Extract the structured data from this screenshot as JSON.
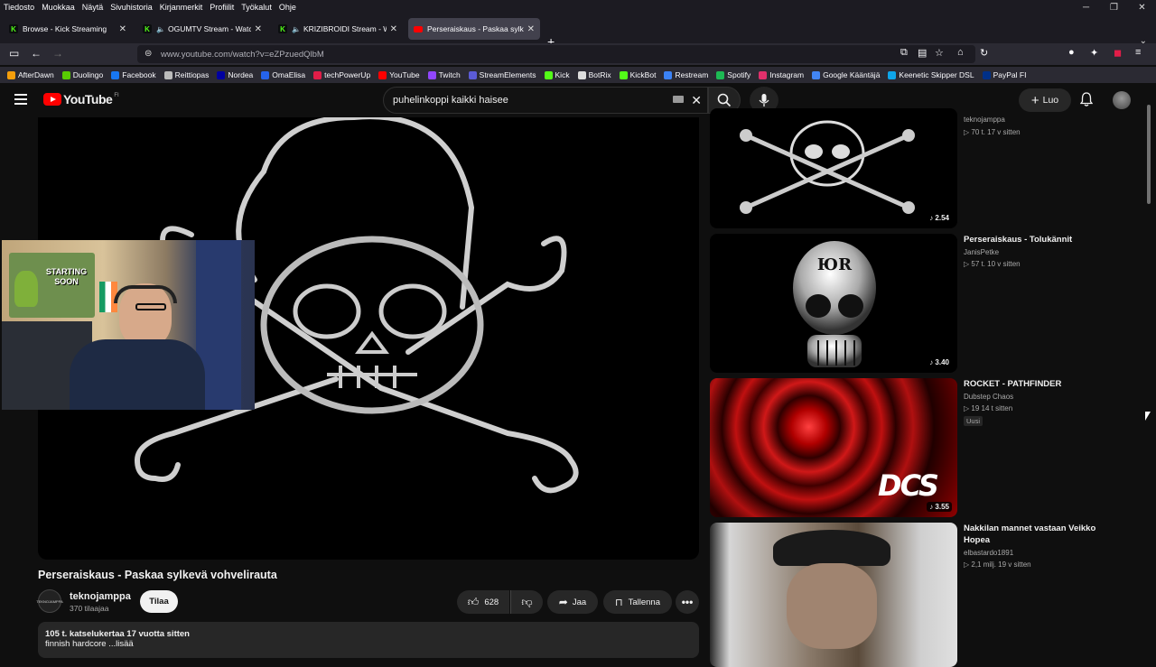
{
  "menubar": [
    "Tiedosto",
    "Muokkaa",
    "Näytä",
    "Sivuhistoria",
    "Kirjanmerkit",
    "Profiilit",
    "Työkalut",
    "Ohje"
  ],
  "tabs": [
    {
      "label": "Browse - Kick Streaming",
      "color": "#53fc18"
    },
    {
      "label": "OGUMTV Stream - Watch L",
      "color": "#53fc18"
    },
    {
      "label": "KRIZIBROIDI Stream - Watc",
      "color": "#53fc18"
    },
    {
      "label": "Perseraiskaus - Paskaa sylkevä v",
      "color": "#ff0000"
    }
  ],
  "url": "www.youtube.com/watch?v=eZPzuedQlbM",
  "bookmarks": [
    {
      "label": "AfterDawn",
      "color": "#f59e0b"
    },
    {
      "label": "Duolingo",
      "color": "#58cc02"
    },
    {
      "label": "Facebook",
      "color": "#1877f2"
    },
    {
      "label": "Reittiopas",
      "color": "#bbbbbb"
    },
    {
      "label": "Nordea",
      "color": "#0000a0"
    },
    {
      "label": "OmaElisa",
      "color": "#2563eb"
    },
    {
      "label": "techPowerUp",
      "color": "#e11d48"
    },
    {
      "label": "YouTube",
      "color": "#ff0000"
    },
    {
      "label": "Twitch",
      "color": "#9146ff"
    },
    {
      "label": "StreamElements",
      "color": "#5b5bd6"
    },
    {
      "label": "Kick",
      "color": "#53fc18"
    },
    {
      "label": "BotRix",
      "color": "#dddddd"
    },
    {
      "label": "KickBot",
      "color": "#53fc18"
    },
    {
      "label": "Restream",
      "color": "#3b82f6"
    },
    {
      "label": "Spotify",
      "color": "#1db954"
    },
    {
      "label": "Instagram",
      "color": "#e1306c"
    },
    {
      "label": "Google Kääntäjä",
      "color": "#4285f4"
    },
    {
      "label": "Keenetic Skipper DSL",
      "color": "#0ea5e9"
    },
    {
      "label": "PayPal FI",
      "color": "#003087"
    }
  ],
  "youtube": {
    "wordmark": "YouTube",
    "country": "FI",
    "search_query": "puhelinkoppi kaikki haisee",
    "create_label": "Luo"
  },
  "video": {
    "title": "Perseraiskaus - Paskaa sylkevä vohvelirauta",
    "channel": "teknojamppa",
    "channel_avatar_text": "TEKNOJAMPPA",
    "subscribers": "370 tilaajaa",
    "subscribe_label": "Tilaa",
    "likes": "628",
    "share_label": "Jaa",
    "save_label": "Tallenna",
    "views_date": "105 t. katselukertaa  17 vuotta sitten",
    "description": "finnish hardcore ...lisää"
  },
  "webcam_sign": "STARTING SOON",
  "recommendations": [
    {
      "title": "",
      "channel": "teknojamppa",
      "meta": "▷ 70 t.   17 v sitten",
      "duration": "2.54",
      "badge": ""
    },
    {
      "title": "Perseraiskaus - Tolukännit",
      "channel": "JanisPetke",
      "meta": "▷ 57 t.   10 v sitten",
      "duration": "3.40",
      "badge": ""
    },
    {
      "title": "ROCKET - PATHFINDER",
      "channel": "Dubstep Chaos",
      "meta": "▷ 19   14 t sitten",
      "duration": "3.55",
      "badge": "Uusi"
    },
    {
      "title": "Nakkilan mannet vastaan Veikko Hopea",
      "channel": "elbastardo1891",
      "meta": "▷ 2,1 milj.   19 v sitten",
      "duration": "",
      "badge": ""
    }
  ],
  "thumb_texts": {
    "dcs": "DCS",
    "skull_emblem": "ЮR"
  }
}
